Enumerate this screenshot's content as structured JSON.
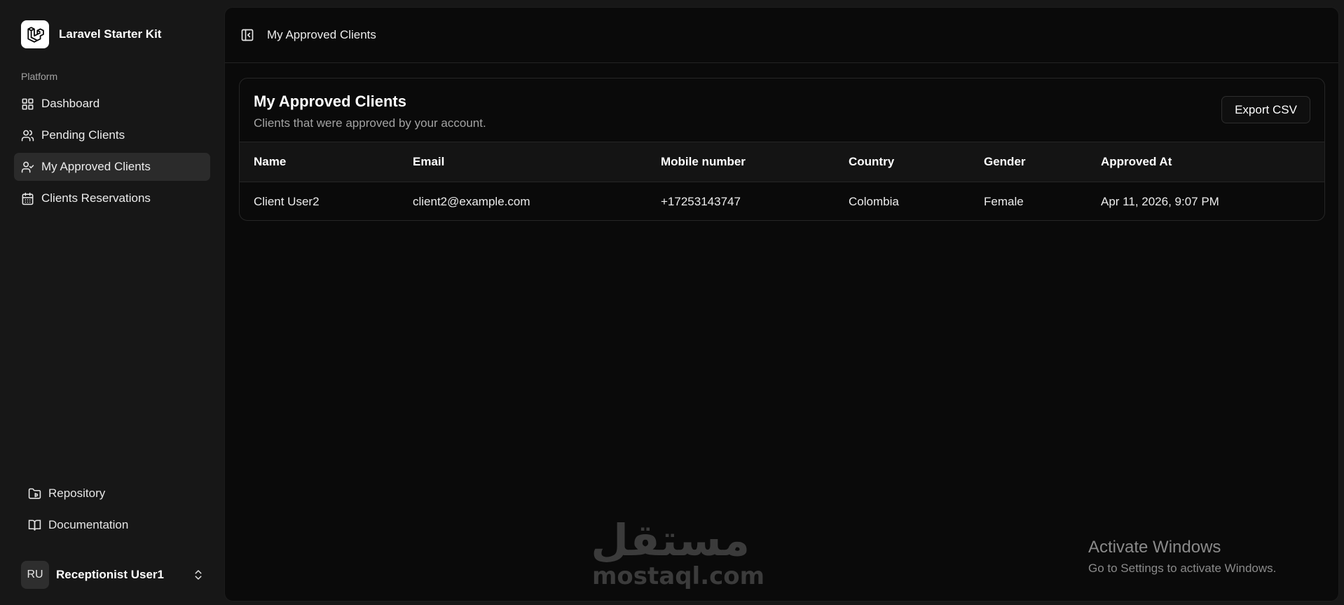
{
  "sidebar": {
    "brand": {
      "name": "Laravel Starter Kit",
      "icon": "laravel-logo-icon"
    },
    "group_label": "Platform",
    "items": [
      {
        "label": "Dashboard",
        "icon": "layout-grid-icon",
        "active": false
      },
      {
        "label": "Pending Clients",
        "icon": "users-icon",
        "active": false
      },
      {
        "label": "My Approved Clients",
        "icon": "user-check-icon",
        "active": true
      },
      {
        "label": "Clients Reservations",
        "icon": "calendar-icon",
        "active": false
      }
    ],
    "footer_links": [
      {
        "label": "Repository",
        "icon": "folder-git-icon"
      },
      {
        "label": "Documentation",
        "icon": "book-open-icon"
      }
    ],
    "user": {
      "initials": "RU",
      "name": "Receptionist User1",
      "icon": "chevrons-up-down-icon"
    }
  },
  "topbar": {
    "toggle_icon": "panel-left-icon",
    "breadcrumb": "My Approved Clients"
  },
  "card": {
    "title": "My Approved Clients",
    "subtitle": "Clients that were approved by your account.",
    "export_label": "Export CSV"
  },
  "table": {
    "columns": [
      "Name",
      "Email",
      "Mobile number",
      "Country",
      "Gender",
      "Approved At"
    ],
    "rows": [
      [
        "Client User2",
        "client2@example.com",
        "+17253143747",
        "Colombia",
        "Female",
        "Apr 11, 2026, 9:07 PM"
      ]
    ]
  },
  "watermarks": {
    "arabic": "مستقل",
    "latin": "mostaql.com",
    "windows_title": "Activate Windows",
    "windows_sub": "Go to Settings to activate Windows."
  },
  "colors": {
    "page_bg": "#171717",
    "panel_bg": "#0a0a0a",
    "active_item_bg": "#2b2b2b",
    "border": "#262626"
  }
}
